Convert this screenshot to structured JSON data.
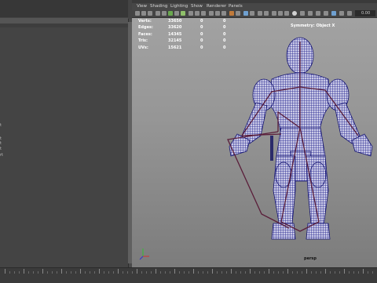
{
  "menus": [
    "View",
    "Shading",
    "Lighting",
    "Show",
    "Renderer",
    "Panels"
  ],
  "hud": {
    "rows": [
      {
        "label": "Verts:",
        "value": "33650",
        "a": "0",
        "b": "0"
      },
      {
        "label": "Edges:",
        "value": "33620",
        "a": "0",
        "b": "0"
      },
      {
        "label": "Faces:",
        "value": "14345",
        "a": "0",
        "b": "0"
      },
      {
        "label": "Tris:",
        "value": "32145",
        "a": "0",
        "b": "0"
      },
      {
        "label": "UVs:",
        "value": "15621",
        "a": "0",
        "b": "0"
      }
    ],
    "symmetry": "Symmetry: Object X"
  },
  "camera": "persp",
  "frame_value": "0.00",
  "side_marks": [
    "t",
    "t",
    "t",
    "t",
    "rt"
  ],
  "colors": {
    "mesh_wire": "#1a1a8a",
    "mesh_fill": "#c9c9e6",
    "skeleton": "#5a1e3a",
    "axis_x": "#d03030",
    "axis_y": "#30c030",
    "axis_z": "#3030d0"
  }
}
